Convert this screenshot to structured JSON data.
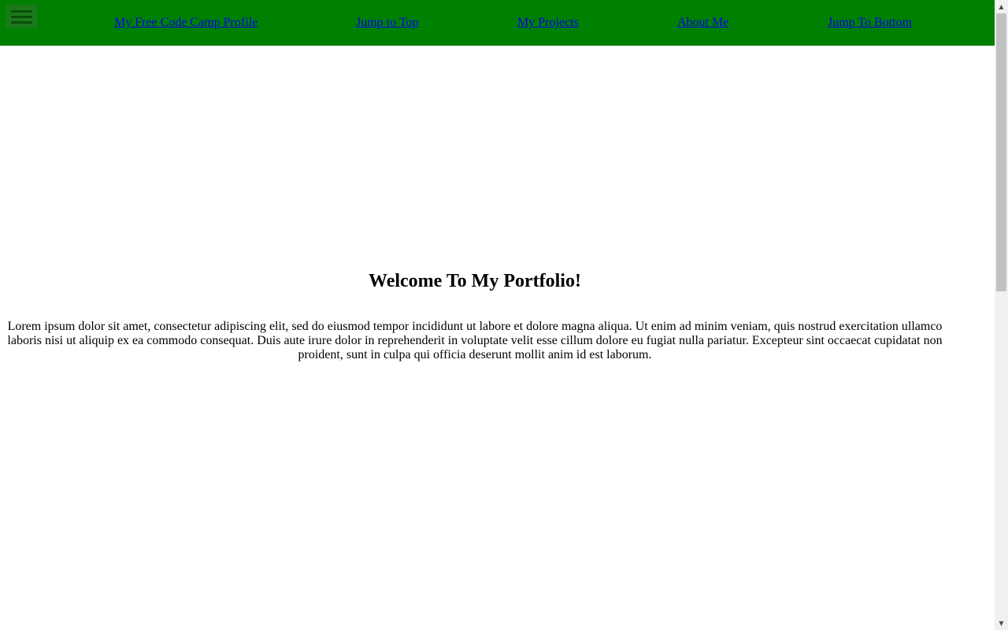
{
  "navbar": {
    "background_color": "#008000",
    "menu_icon": "hamburger-menu-icon",
    "links": [
      {
        "label": "My Free Code Camp Profile"
      },
      {
        "label": "Jump to Top"
      },
      {
        "label": "My Projects"
      },
      {
        "label": "About Me"
      },
      {
        "label": "Jump To Bottom"
      }
    ],
    "link_color": "#0000ee"
  },
  "main": {
    "title": "Welcome To My Portfolio!",
    "paragraph": "Lorem ipsum dolor sit amet, consectetur adipiscing elit, sed do eiusmod tempor incididunt ut labore et dolore magna aliqua. Ut enim ad minim veniam, quis nostrud exercitation ullamco laboris nisi ut aliquip ex ea commodo consequat. Duis aute irure dolor in reprehenderit in voluptate velit esse cillum dolore eu fugiat nulla pariatur. Excepteur sint occaecat cupidatat non proident, sunt in culpa qui officia deserunt mollit anim id est laborum."
  },
  "scrollbar": {
    "up_icon": "scroll-up-arrow-icon",
    "down_icon": "scroll-down-arrow-icon"
  }
}
